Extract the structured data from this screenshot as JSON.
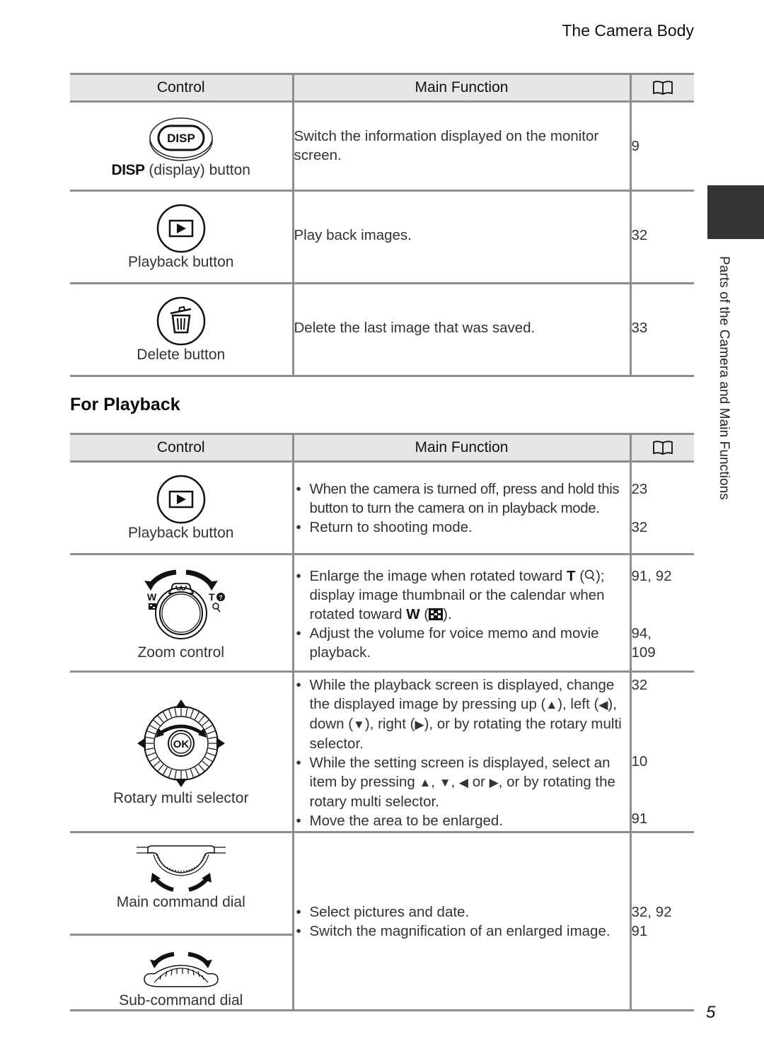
{
  "running_head": "The Camera Body",
  "side_label": "Parts of the Camera and Main Functions",
  "page_number": "5",
  "headers": {
    "control": "Control",
    "main_function": "Main Function",
    "ref_icon": "book-icon"
  },
  "table1": {
    "rows": [
      {
        "icon": "disp-button-icon",
        "label_bold": "DISP",
        "label": "(display) button",
        "function": "Switch the information displayed on the monitor screen.",
        "ref": "9"
      },
      {
        "icon": "playback-button-icon",
        "label": "Playback button",
        "function": "Play back images.",
        "ref": "32"
      },
      {
        "icon": "delete-button-icon",
        "label": "Delete button",
        "function": "Delete the last image that was saved.",
        "ref": "33"
      }
    ]
  },
  "section_title": "For Playback",
  "table2": {
    "rows": [
      {
        "icon": "playback-button-icon",
        "label": "Playback button",
        "bullets": [
          {
            "text": "When the camera is turned off, press and hold this button to turn the camera on in playback mode.",
            "ref": "23"
          },
          {
            "text": "Return to shooting mode.",
            "ref": "32"
          }
        ]
      },
      {
        "icon": "zoom-control-icon",
        "label": "Zoom control",
        "bullets": [
          {
            "text_a": "Enlarge the image when rotated toward ",
            "t_key": "T",
            "text_b": " (",
            "text_c": "); display image thumbnail or the calendar when rotated toward ",
            "w_key": "W",
            "text_d": " (",
            "text_e": ").",
            "ref": "91, 92"
          },
          {
            "text": "Adjust the volume for voice memo and movie playback.",
            "ref_line1": "94,",
            "ref_line2": "109"
          }
        ]
      },
      {
        "icon": "rotary-multi-selector-icon",
        "label": "Rotary multi selector",
        "bullets": [
          {
            "p1": "While the playback screen is displayed, change the displayed image by pressing up (",
            "up": "▲",
            "p2": "), left (",
            "left": "◀",
            "p3": "), down (",
            "down": "▼",
            "p4": "), right (",
            "right": "▶",
            "p5": "), or by rotating the rotary multi selector.",
            "ref": "32"
          },
          {
            "p1": "While the setting screen is displayed, select an item by pressing ",
            "up": "▲",
            "sep1": ", ",
            "down": "▼",
            "sep2": ", ",
            "left": "◀",
            "sep3": " or ",
            "right": "▶",
            "p2": ", or by rotating the rotary multi selector.",
            "ref": "10"
          },
          {
            "text": "Move the area to be enlarged.",
            "ref": "91"
          }
        ]
      },
      {
        "icon": "main-command-dial-icon",
        "label": "Main command dial",
        "sub_icon": "sub-command-dial-icon",
        "sub_label": "Sub-command dial",
        "bullets": [
          {
            "text": "Select pictures and date.",
            "ref": "32, 92"
          },
          {
            "text": "Switch the magnification of an enlarged image.",
            "ref": "91"
          }
        ]
      }
    ]
  }
}
